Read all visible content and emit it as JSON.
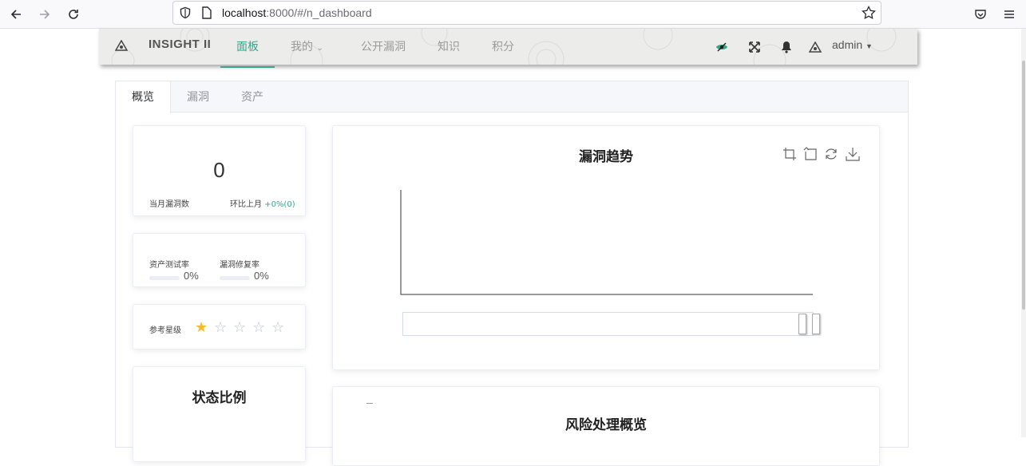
{
  "browser": {
    "url_host": "localhost",
    "url_rest": ":8000/#/n_dashboard"
  },
  "header": {
    "brand": "INSIGHT II",
    "menu": [
      {
        "label": "面板"
      },
      {
        "label": "我的"
      },
      {
        "label": "公开漏洞"
      },
      {
        "label": "知识"
      },
      {
        "label": "积分"
      }
    ],
    "user": "admin"
  },
  "tabs": [
    {
      "label": "概览"
    },
    {
      "label": "漏洞"
    },
    {
      "label": "资产"
    }
  ],
  "stats": {
    "count": "0",
    "count_label": "当月漏洞数",
    "compare_label": "环比上月",
    "compare_value": "+0%(0)"
  },
  "rates": {
    "asset_label": "资产测试率",
    "asset_value": "0%",
    "asset_progress": 0,
    "fix_label": "漏洞修复率",
    "fix_value": "0%",
    "fix_progress": 0
  },
  "rating": {
    "label": "参考星级",
    "value": 1,
    "max": 5
  },
  "status_section": {
    "title": "状态比例"
  },
  "trend_chart": {
    "title": "漏洞趋势"
  },
  "risk_section": {
    "title": "风险处理概览"
  },
  "colors": {
    "accent": "#3aa38b",
    "star": "#f7ba2a"
  }
}
